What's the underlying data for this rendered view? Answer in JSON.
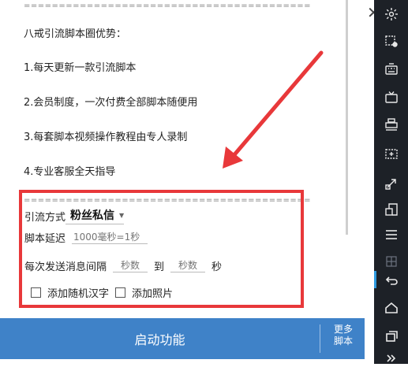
{
  "info": {
    "separator": "=========================================",
    "title": "八戒引流脚本圈优势：",
    "items": [
      "1.每天更新一款引流脚本",
      "2.会员制度，一次付费全部脚本随便用",
      "3.每套脚本视频操作教程由专人录制",
      "4.专业客服全天指导"
    ]
  },
  "form": {
    "method_label": "引流方式",
    "method_value": "粉丝私信",
    "delay_label": "脚本延迟",
    "delay_placeholder": "1000毫秒=1秒",
    "interval_label": "每次发送消息间隔",
    "interval_from_placeholder": "秒数",
    "interval_to_label": "到",
    "interval_to_placeholder": "秒数",
    "interval_unit": "秒",
    "random_chars_label": "添加随机汉字",
    "random_chars_checked": false,
    "add_photo_label": "添加照片",
    "add_photo_checked": false
  },
  "actions": {
    "start_label": "启动功能",
    "more_line1": "更多",
    "more_line2": "脚本"
  },
  "colors": {
    "accent_blue": "#3f82c8",
    "highlight_red": "#e8383a",
    "toolbar_bg": "#1d2127"
  },
  "toolbar_icons": [
    "brightness-icon",
    "screen-record-icon",
    "keyboard-icon",
    "tv-icon",
    "printer-icon",
    "install-apk-icon",
    "resize-icon",
    "multi-window-icon",
    "menu-icon",
    "back-icon",
    "home-icon",
    "recents-icon",
    "expand-icon"
  ]
}
